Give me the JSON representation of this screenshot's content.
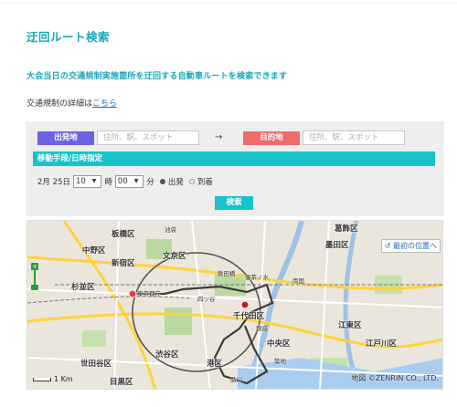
{
  "page": {
    "title": "迂回ルート検索",
    "description": "大会当日の交通規制実施箇所を迂回する自動車ルートを検索できます",
    "details_prefix": "交通規制の詳細は",
    "details_link": "こちら"
  },
  "search": {
    "origin_label": "出発地",
    "origin_placeholder": "住所、駅、スポット",
    "arrow": "→",
    "dest_label": "目的地",
    "dest_placeholder": "住所、駅、スポット",
    "conditions_header": "移動手段/日時指定",
    "date": "2月 25日",
    "hour_value": "10",
    "hour_unit": "時",
    "minute_value": "00",
    "minute_unit": "分",
    "option_depart": "出発",
    "option_arrive": "到着",
    "selected_option": "出発",
    "submit": "検索"
  },
  "map": {
    "reset_label": "最初の位置へ",
    "scale_label": "1 Km",
    "copyright": "地図 ©ZENRIN CO., LTD.",
    "labels": {
      "itabashi": "板橋区",
      "nakano": "中野区",
      "shinjuku": "新宿区",
      "suginami": "杉並区",
      "shibuya": "渋谷区",
      "setagaya": "世田谷区",
      "meguro": "目黒区",
      "bunkyo": "文京区",
      "chiyoda": "千代田区",
      "chuo": "中央区",
      "minato": "港区",
      "sumida": "墨田区",
      "koto": "江東区",
      "katsushika": "葛飾区",
      "edogawa": "江戸川区",
      "tokyo_tocho": "東京都庁",
      "iidabashi": "飯田橋",
      "yotsuya": "四ツ谷",
      "ochanomizu": "御茶ノ水",
      "ginza": "銀座",
      "ryogoku": "両国",
      "ikebukuro": "池袋",
      "tsukiji": "築地",
      "shinagawa_rail": "品川"
    }
  },
  "colors": {
    "accent": "#1aa7b8",
    "cyan_bar": "#18c2cb",
    "origin": "#6d63e6",
    "destination": "#f26a6a",
    "link": "#1a6fc4"
  }
}
